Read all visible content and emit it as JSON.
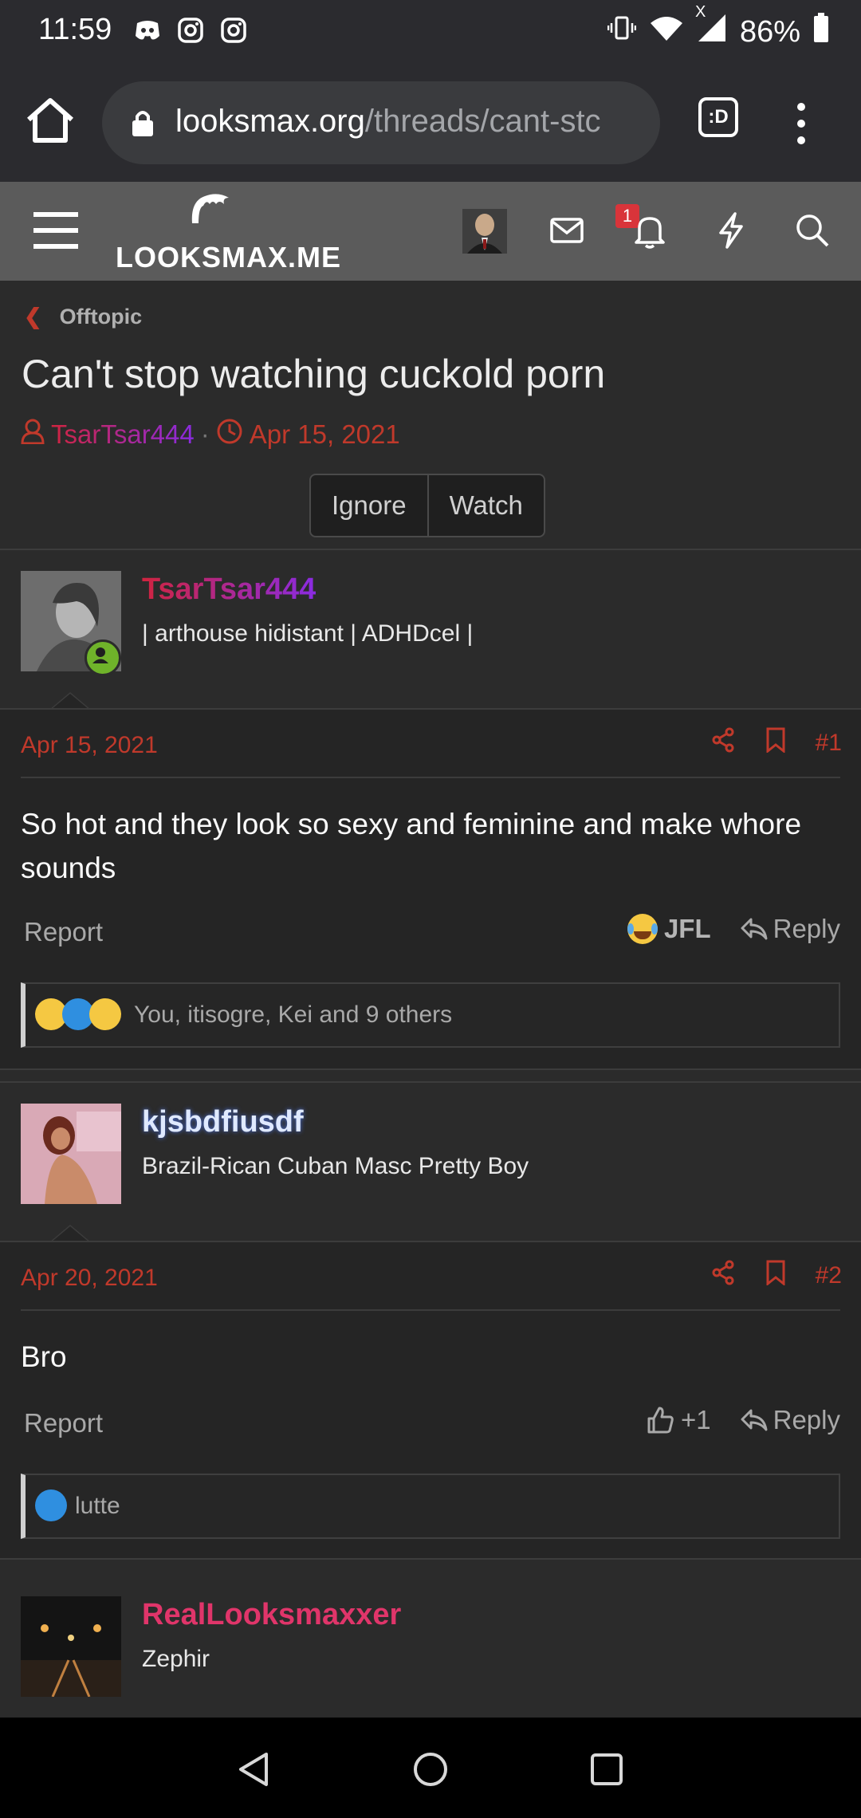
{
  "status_bar": {
    "time": "11:59",
    "left_icons": [
      "discord-icon",
      "instagram-icon",
      "instagram-icon"
    ],
    "battery_percent": "86%",
    "x_mark": "X"
  },
  "browser": {
    "url_host": "looksmax.org",
    "url_path": "/threads/cant-stc",
    "d_button": ":D"
  },
  "site": {
    "logo_text": "LOOKSMAX.ME",
    "notification_count": "1"
  },
  "thread": {
    "breadcrumb": "Offtopic",
    "title": "Can't stop watching cuckold porn",
    "author": "TsarTsar444",
    "date": "Apr 15, 2021",
    "buttons": {
      "ignore": "Ignore",
      "watch": "Watch"
    }
  },
  "posts": [
    {
      "username": "TsarTsar444",
      "username_color": "#c0185c",
      "subtitle": "| arthouse hidistant | ADHDcel |",
      "date": "Apr 15, 2021",
      "number": "#1",
      "text": "So hot and they look so sexy and feminine and make whore sounds",
      "report": "Report",
      "reaction_label": "JFL",
      "reply": "Reply",
      "reactions_summary": "You, itisogre, Kei and 9 others"
    },
    {
      "username": "kjsbdfiusdf",
      "username_color": "#d9e6ff",
      "subtitle": "Brazil-Rican Cuban Masc Pretty Boy",
      "date": "Apr 20, 2021",
      "number": "#2",
      "text": "Bro",
      "report": "Report",
      "like_label": "+1",
      "reply": "Reply",
      "reactions_summary": "lutte"
    },
    {
      "username": "RealLooksmaxxer",
      "username_color": "#e0356a",
      "subtitle": "Zephir"
    }
  ],
  "colors": {
    "accent": "#c0392b",
    "header_bg": "#5b5b5b",
    "page_bg": "#2b2b2b"
  }
}
